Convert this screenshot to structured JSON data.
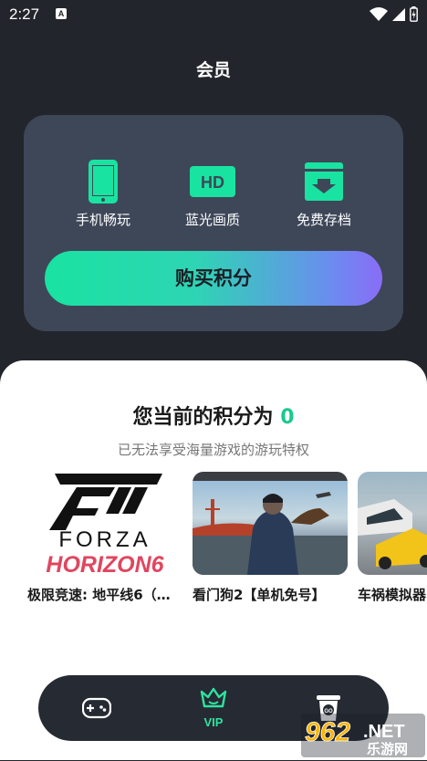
{
  "status": {
    "time": "2:27",
    "notification_glyph": "A"
  },
  "header": {
    "title": "会员"
  },
  "vip_card": {
    "features": [
      {
        "icon": "phone-icon",
        "label": "手机畅玩"
      },
      {
        "icon": "hd-icon",
        "label": "蓝光画质",
        "badge": "HD"
      },
      {
        "icon": "cloud-save-icon",
        "label": "免费存档"
      }
    ],
    "buy_label": "购买积分"
  },
  "points": {
    "prefix": "您当前的积分为",
    "value": "0",
    "notice": "已无法享受海量游戏的游玩特权"
  },
  "games": [
    {
      "title": "极限竞速: 地平线6（…",
      "cover_line1": "FORZA",
      "cover_line2": "HORIZON6"
    },
    {
      "title": "看门狗2【单机免号】"
    },
    {
      "title": "车祸模拟器"
    }
  ],
  "tab_bar": {
    "tabs": [
      {
        "icon": "gamepad-icon"
      },
      {
        "icon": "crown-icon",
        "label": "VIP"
      },
      {
        "icon": "cup-icon",
        "icon_text": "GO"
      }
    ]
  },
  "watermark": {
    "number": "962",
    "suffix": ".NET",
    "subtitle": "乐游网"
  },
  "colors": {
    "accent": "#19e3a1",
    "card_bg": "#3e4758",
    "page_bg": "#23252c",
    "points_green": "#19c98c"
  }
}
